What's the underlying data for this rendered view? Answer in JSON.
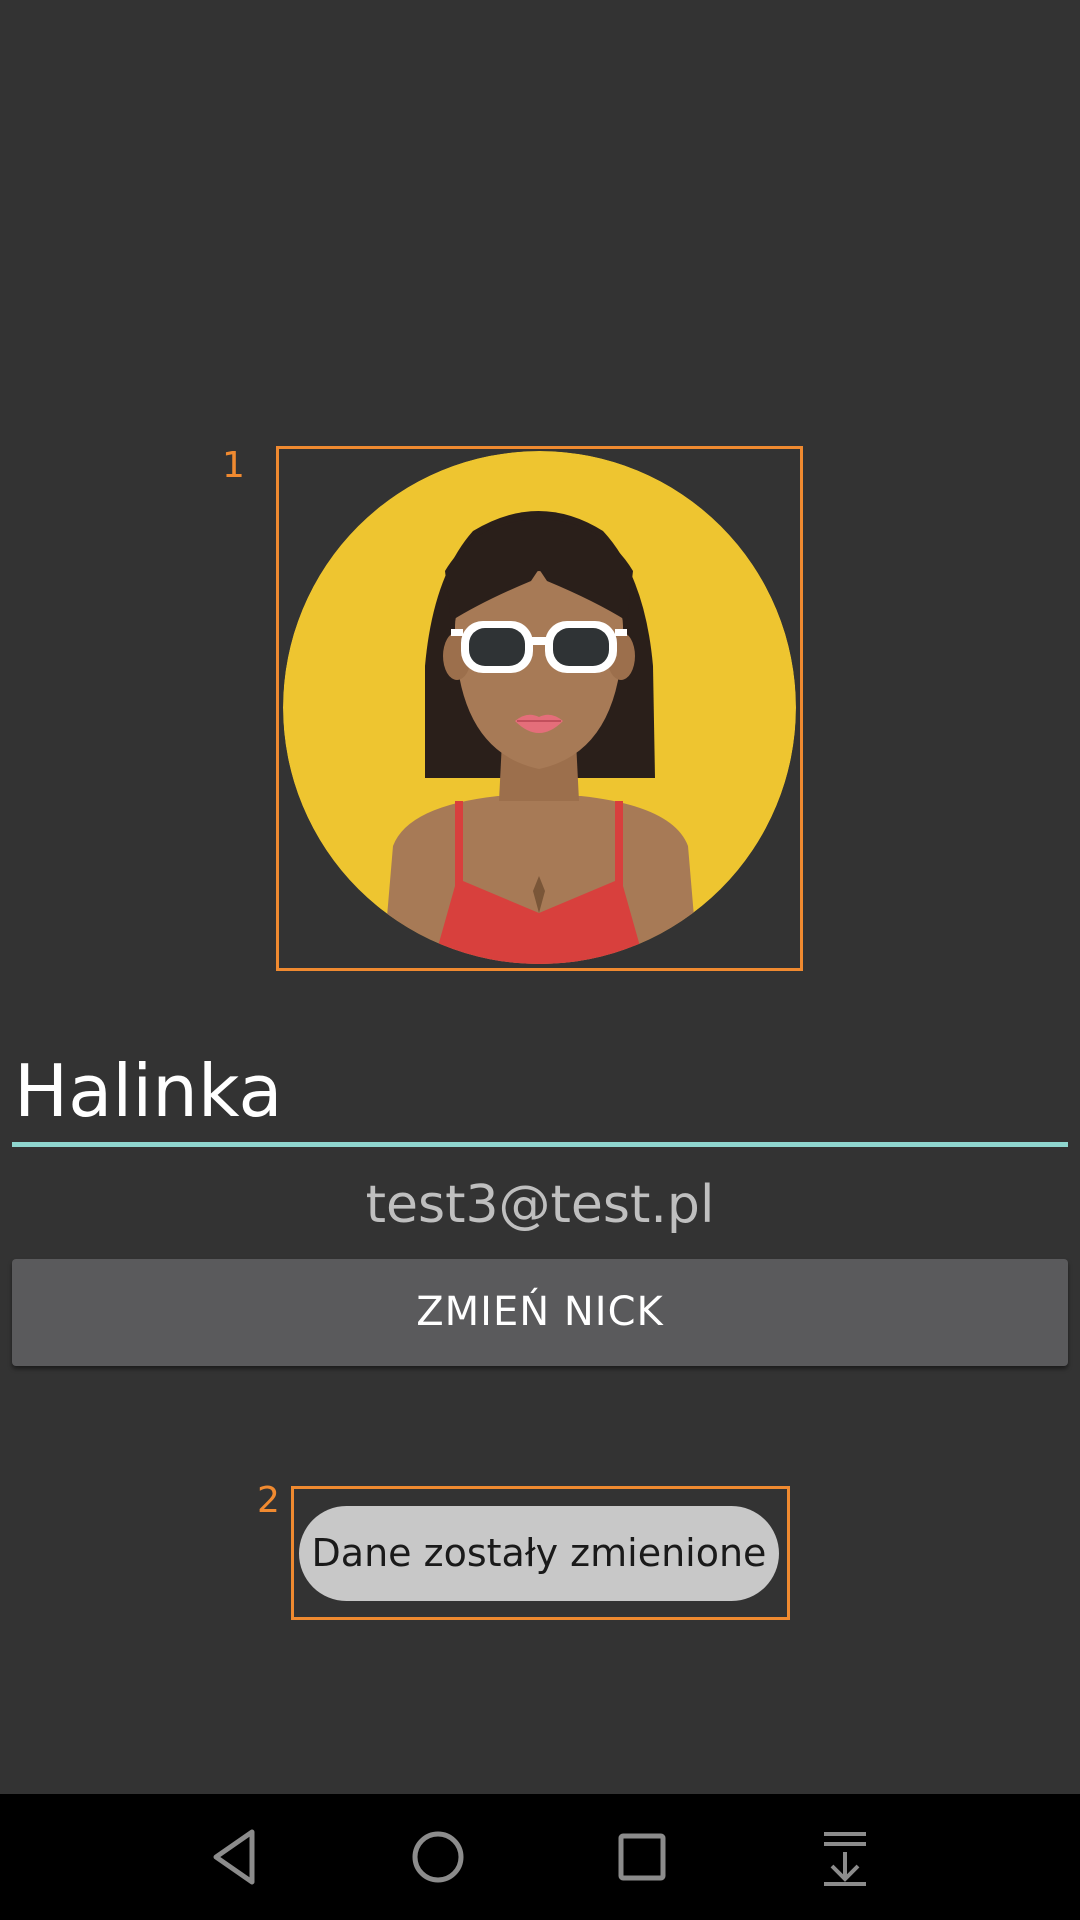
{
  "annotations": [
    "1",
    "2"
  ],
  "avatar": {
    "icon": "woman-with-sunglasses-avatar"
  },
  "profile": {
    "nick_value": "Halinka",
    "email": "test3@test.pl",
    "change_nick_label": "ZMIEŃ NICK"
  },
  "toast": {
    "message": "Dane zostały zmienione"
  },
  "navbar": {
    "icons": [
      "back-icon",
      "home-icon",
      "recent-apps-icon",
      "notifications-pull-icon"
    ]
  },
  "colors": {
    "background": "#333333",
    "accent_underline": "#8FD6CF",
    "annotation": "#F08A30",
    "avatar_background": "#EEC530",
    "button": "#5A5A5C",
    "toast": "#C8C8C8"
  }
}
